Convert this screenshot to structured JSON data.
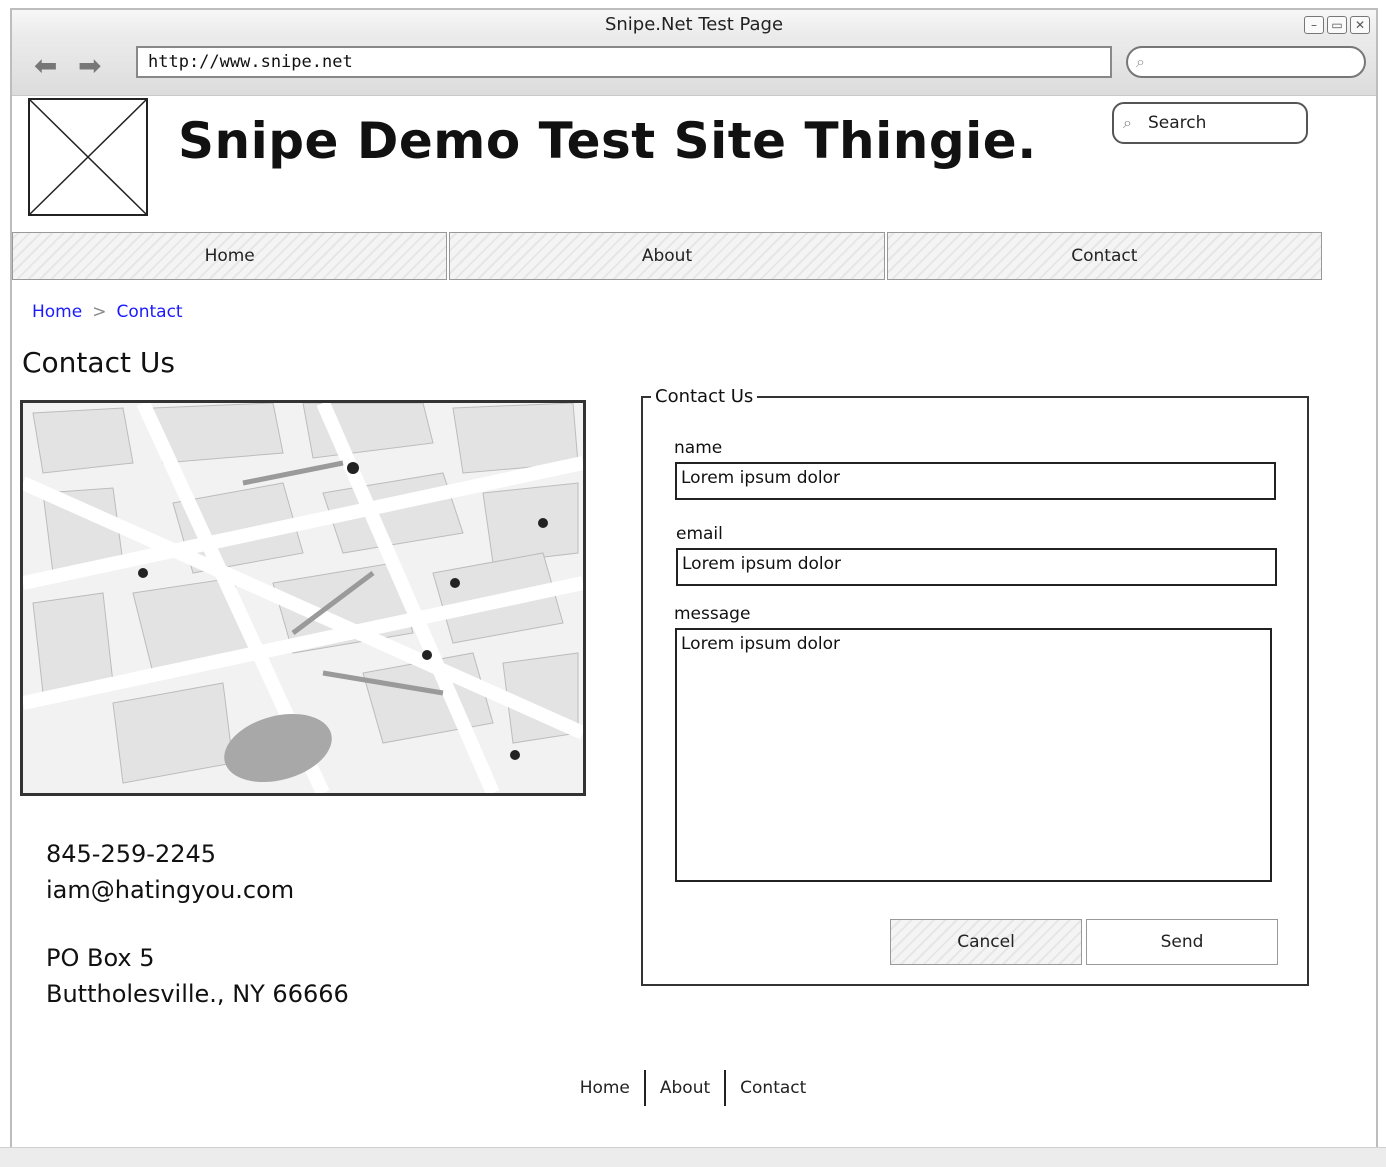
{
  "window": {
    "title": "Snipe.Net Test Page",
    "url": "http://www.snipe.net"
  },
  "header": {
    "site_title": "Snipe Demo Test Site Thingie.",
    "search_label": "Search"
  },
  "nav": {
    "items": [
      {
        "label": "Home"
      },
      {
        "label": "About"
      },
      {
        "label": "Contact"
      }
    ]
  },
  "breadcrumb": {
    "items": [
      "Home",
      "Contact"
    ],
    "separator": ">"
  },
  "page": {
    "heading": "Contact Us"
  },
  "contact_info": {
    "phone": "845-259-2245",
    "email": "iam@hatingyou.com",
    "address_line1": "PO Box 5",
    "address_line2": "Buttholesville., NY 66666"
  },
  "form": {
    "legend": "Contact Us",
    "name_label": "name",
    "name_value": "Lorem ipsum dolor",
    "email_label": "email",
    "email_value": "Lorem ipsum dolor",
    "message_label": "message",
    "message_value": "Lorem ipsum dolor",
    "cancel_label": "Cancel",
    "send_label": "Send"
  },
  "footer": {
    "links": [
      "Home",
      "About",
      "Contact"
    ]
  },
  "colors": {
    "link": "#1a1aff",
    "ink": "#111111",
    "chrome": "#e4e4e4"
  }
}
